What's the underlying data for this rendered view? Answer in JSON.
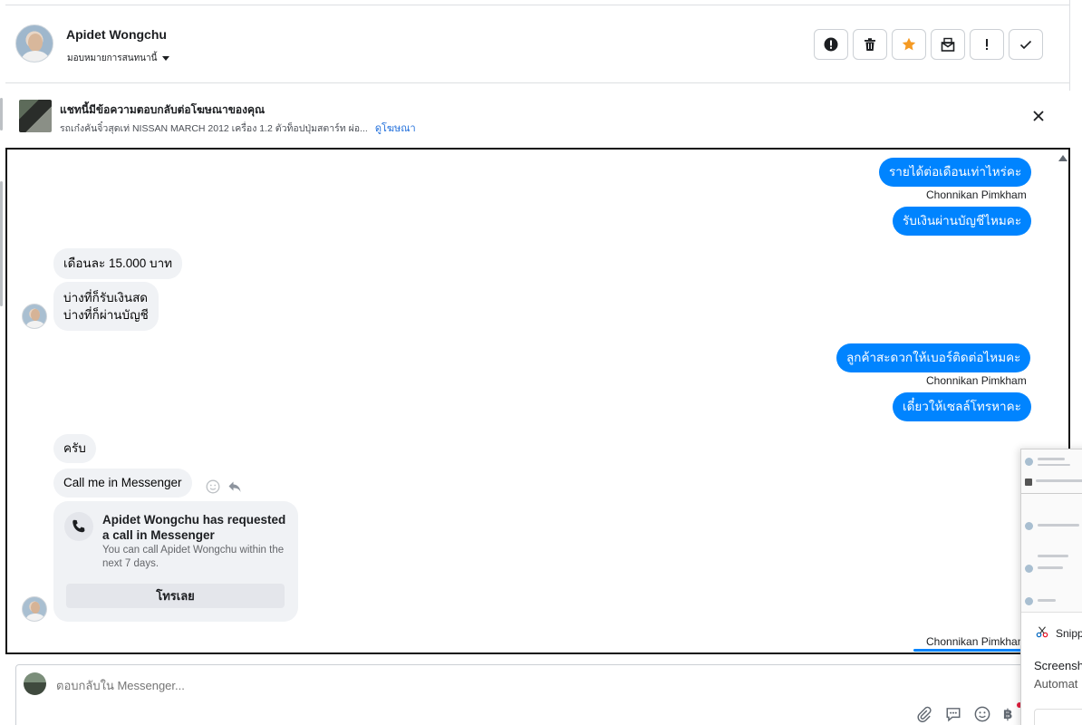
{
  "header": {
    "contact_name": "Apidet Wongchu",
    "assign_label": "มอบหมายการสนทนานี้",
    "tools": [
      {
        "name": "spam-report-button",
        "icon": "alert-circle-icon"
      },
      {
        "name": "delete-button",
        "icon": "trash-icon"
      },
      {
        "name": "star-button",
        "icon": "star-icon"
      },
      {
        "name": "mark-unread-button",
        "icon": "envelope-open-icon"
      },
      {
        "name": "follow-up-button",
        "icon": "exclamation-icon"
      },
      {
        "name": "mark-done-button",
        "icon": "check-icon"
      }
    ],
    "star_color": "#f59a23"
  },
  "ad": {
    "title": "แชทนี้มีข้อความตอบกลับต่อโฆษณาของคุณ",
    "subtitle": "รถเก๋งคันจิ๋วสุดเท่ NISSAN MARCH 2012 เครื่อง 1.2 ตัวท็อปปุ่มสตาร์ท ผ่อ...",
    "link": "ดูโฆษณา"
  },
  "messages": {
    "m1": "รายได้ต่อเดือนเท่าไหร่คะ",
    "sender1": "Chonnikan Pimkham",
    "m2": "รับเงินผ่านบัญชีไหมคะ",
    "m3": "เดือนละ 15.000 บาท",
    "m4_line1": "บ่างที่ก็รับเงินสด",
    "m4_line2": "บ่างที่ก็ผ่านบัญชี",
    "m5": "ลูกค้าสะดวกให้เบอร์ติดต่อไหมคะ",
    "sender2": "Chonnikan Pimkham",
    "m6": "เดี๋ยวให้เซลล์โทรหาคะ",
    "m7": "ครับ",
    "m8": "Call me in Messenger",
    "bottom_sender": "Chonnikan Pimkham"
  },
  "call_card": {
    "title": "Apidet Wongchu has requested a call in Messenger",
    "description": "You can call Apidet Wongchu within the next 7 days.",
    "button": "โทรเลย"
  },
  "composer": {
    "placeholder": "ตอบกลับใน Messenger..."
  },
  "snipping": {
    "app_name": "Snipp",
    "line1": "Screensh",
    "line2": "Automat"
  },
  "colors": {
    "outgoing_bubble": "#0084ff",
    "incoming_bubble": "#f0f2f5",
    "link": "#216fdb"
  }
}
